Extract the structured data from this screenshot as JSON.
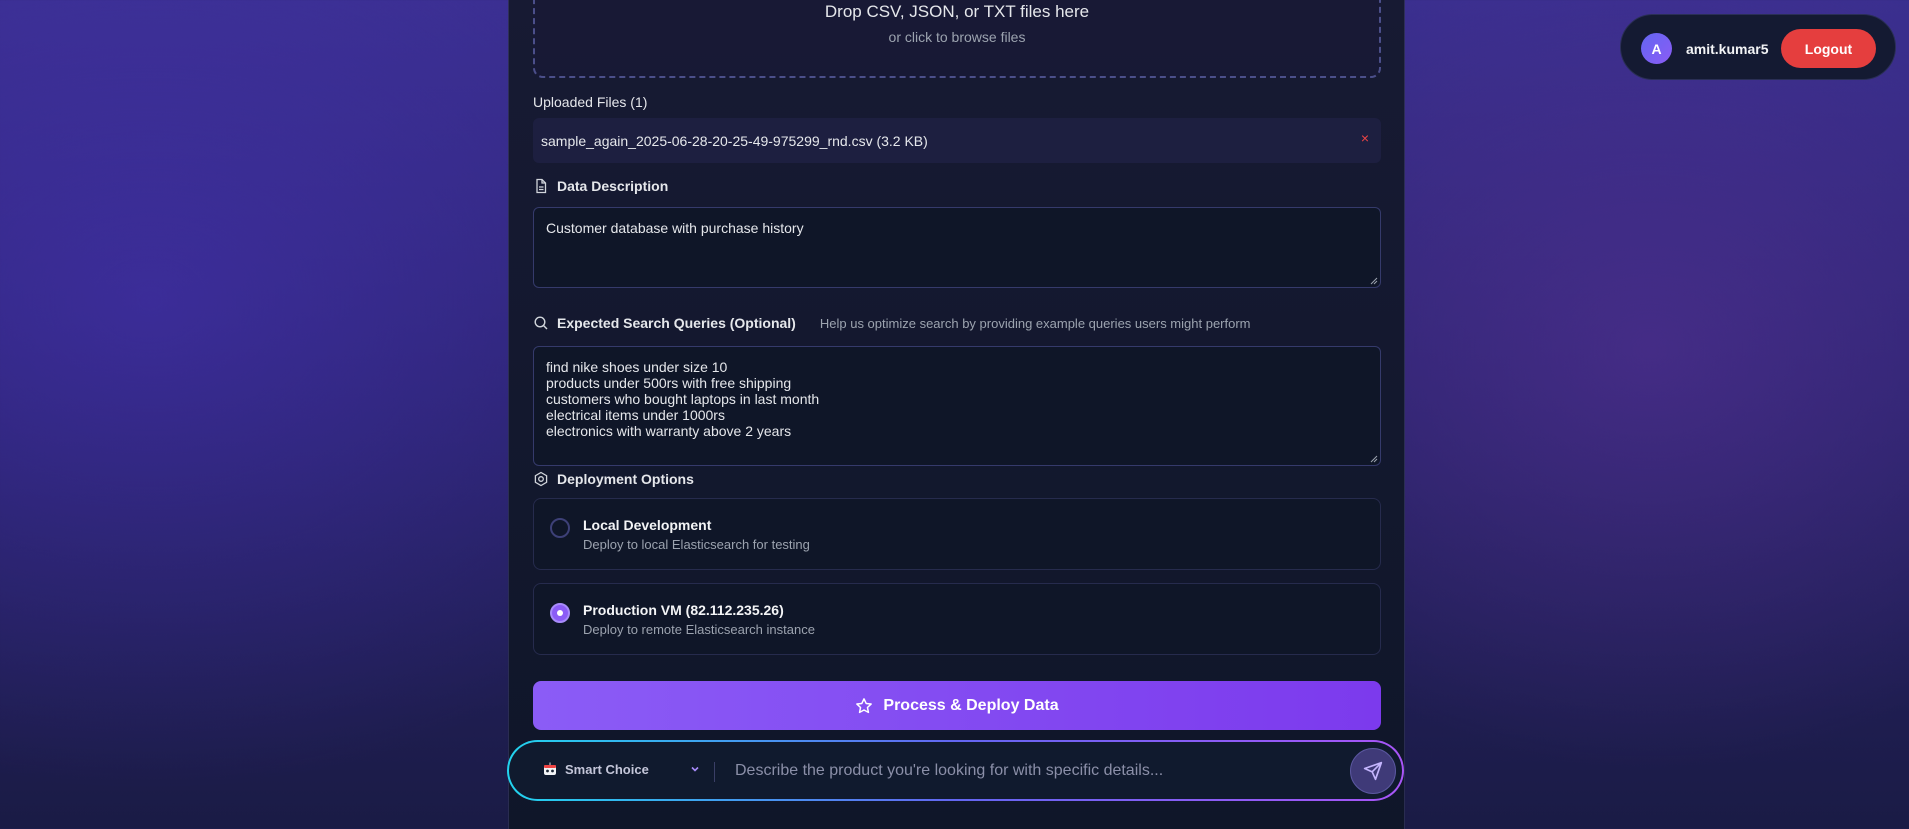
{
  "upload": {
    "drop_title": "Drop CSV, JSON, or TXT files here",
    "drop_subtitle": "or click to browse files",
    "uploaded_label": "Uploaded Files (1)",
    "files": [
      {
        "name": "sample_again_2025-06-28-20-25-49-975299_rnd.csv (3.2 KB)",
        "remove": "×"
      }
    ]
  },
  "description": {
    "title": "Data Description",
    "value": "Customer database with purchase history",
    "icon": "document-icon"
  },
  "queries": {
    "title": "Expected Search Queries (Optional)",
    "hint": "Help us optimize search by providing example queries users might perform",
    "lines": [
      "find nike shoes under size 10",
      "products under 500rs with free shipping",
      "customers who bought laptops in last month",
      "electrical items under 1000rs",
      "electronics with warranty above 2 years"
    ],
    "icon": "search-icon"
  },
  "deployment": {
    "title": "Deployment Options",
    "icon": "gear-icon",
    "options": [
      {
        "title": "Local Development",
        "subtitle": "Deploy to local Elasticsearch for testing",
        "selected": false
      },
      {
        "title": "Production VM (82.112.235.26)",
        "subtitle": "Deploy to remote Elasticsearch instance",
        "selected": true
      }
    ]
  },
  "action": {
    "label": "Process & Deploy Data",
    "icon": "star-icon"
  },
  "chat": {
    "model_label": "Smart Choice",
    "model_icon": "robot-icon",
    "placeholder": "Describe the product you're looking for with specific details...",
    "send_icon": "send-icon"
  },
  "user": {
    "initial": "A",
    "name": "amit.kumar5",
    "logout_label": "Logout"
  },
  "colors": {
    "accent": "#8b5cf6",
    "logout": "#e53e3e",
    "remove": "#ef4444"
  }
}
